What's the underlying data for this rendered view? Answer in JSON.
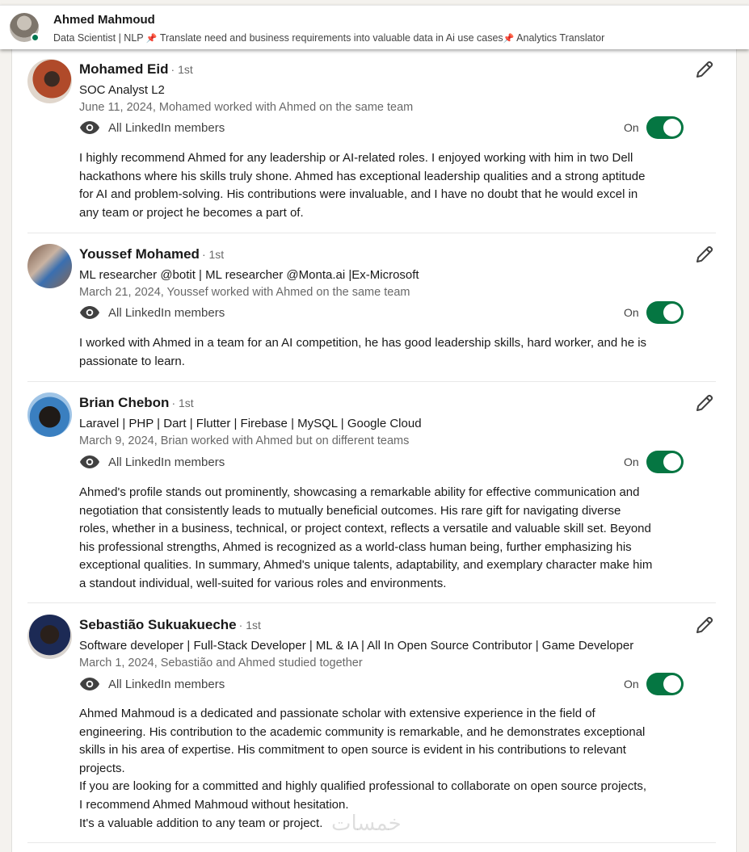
{
  "header": {
    "name": "Ahmed Mahmoud",
    "headline_parts": [
      "Data Scientist | NLP",
      "Translate need and business requirements into valuable data in Ai use cases",
      "Analytics Translator"
    ],
    "pin_icon": "📌"
  },
  "visibility_label": "All LinkedIn members",
  "toggle_label": "On",
  "colors": {
    "toggle_on": "#057642",
    "presence": "#01754f",
    "pin": "#d9342b"
  },
  "recommendations": [
    {
      "name": "Mohamed Eid",
      "degree": "· 1st",
      "headline": "SOC Analyst L2",
      "date": "June 11, 2024, Mohamed worked with Ahmed on the same team",
      "text": "I highly recommend Ahmed for any leadership or AI-related roles. I enjoyed working with him in two Dell\nhackathons where his skills truly shone. Ahmed has exceptional leadership qualities and a strong aptitude\nfor AI and problem-solving. His contributions were invaluable, and I have no doubt that he would excel in\nany team or project he becomes a part of."
    },
    {
      "name": "Youssef Mohamed",
      "degree": "· 1st",
      "headline": "ML researcher @botit | ML researcher @Monta.ai |Ex-Microsoft",
      "date": "March 21, 2024, Youssef worked with Ahmed on the same team",
      "text": "I worked with Ahmed in a team for an AI competition, he has good leadership skills, hard worker, and he is\npassionate to learn."
    },
    {
      "name": "Brian Chebon",
      "degree": "· 1st",
      "headline": "Laravel | PHP | Dart | Flutter | Firebase | MySQL | Google Cloud",
      "date": "March 9, 2024, Brian worked with Ahmed but on different teams",
      "text": "Ahmed's profile stands out prominently, showcasing a remarkable ability for effective communication and\nnegotiation that consistently leads to mutually beneficial outcomes. His rare gift for navigating diverse\nroles, whether in a business, technical, or project context, reflects a versatile and valuable skill set. Beyond\nhis professional strengths, Ahmed is recognized as a world-class human being, further emphasizing his\nexceptional qualities. In summary, Ahmed's unique talents, adaptability, and exemplary character make him\na standout individual, well-suited for various roles and environments."
    },
    {
      "name": "Sebastião Sukuakueche",
      "degree": "· 1st",
      "headline": "Software developer | Full-Stack Developer | ML & IA | All In Open Source Contributor | Game Developer",
      "date": "March 1, 2024, Sebastião and Ahmed studied together",
      "text": "Ahmed Mahmoud is a dedicated and passionate scholar with extensive experience in the field of\nengineering. His contribution to the academic community is remarkable, and he demonstrates exceptional\nskills in his area of expertise. His commitment to open source is evident in his contributions to relevant\nprojects.\nIf you are looking for a committed and highly qualified professional to collaborate on open source projects,\nI recommend Ahmed Mahmoud without hesitation.\n It's a valuable addition to any team or project."
    }
  ],
  "watermark": "خمسات"
}
